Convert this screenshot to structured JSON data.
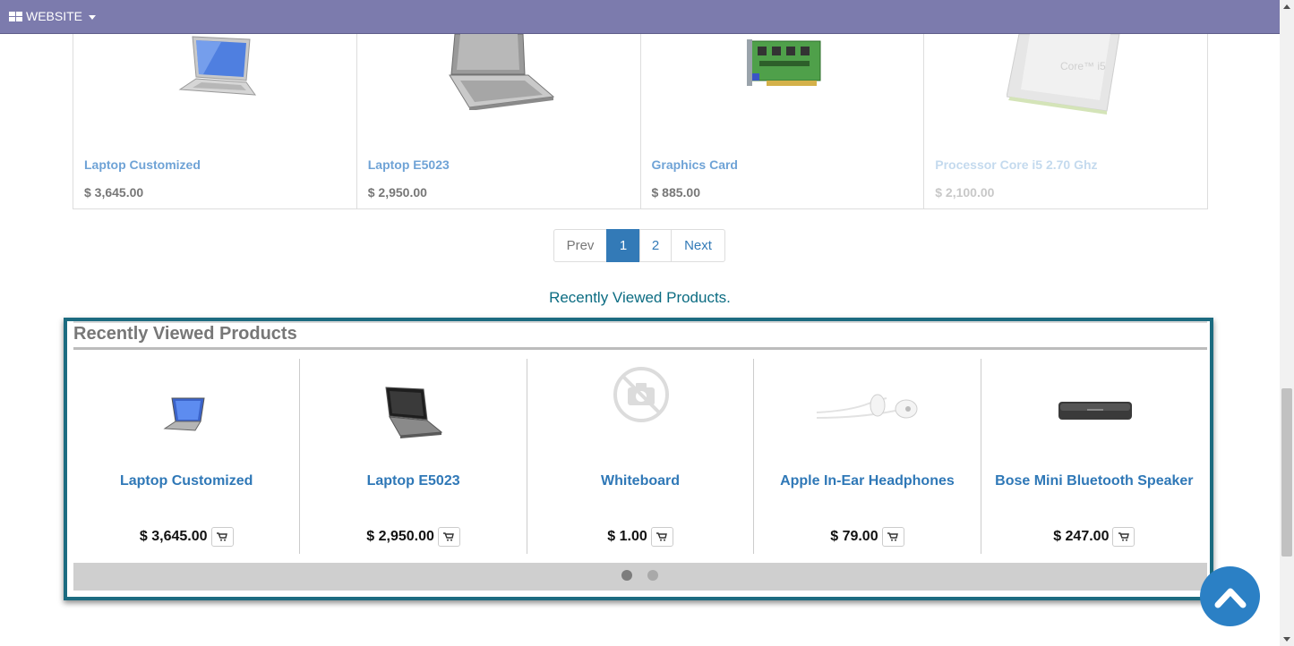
{
  "topbar": {
    "menu_label": "WEBSITE",
    "background": "#7c7bad"
  },
  "products": [
    {
      "name": "Laptop Customized",
      "price": "$ 3,645.00"
    },
    {
      "name": "Laptop E5023",
      "price": "$ 2,950.00"
    },
    {
      "name": "Graphics Card",
      "price": "$ 885.00"
    },
    {
      "name": "Processor Core i5 2.70 Ghz",
      "price": "$ 2,100.00"
    }
  ],
  "pagination": {
    "prev": "Prev",
    "pages": [
      "1",
      "2"
    ],
    "active": "1",
    "next": "Next"
  },
  "recent_link": "Recently Viewed Products.",
  "recent": {
    "title": "Recently Viewed Products",
    "items": [
      {
        "name": "Laptop Customized",
        "price": "$ 3,645.00"
      },
      {
        "name": "Laptop E5023",
        "price": "$ 2,950.00"
      },
      {
        "name": "Whiteboard",
        "price": "$ 1.00"
      },
      {
        "name": "Apple In-Ear Headphones",
        "price": "$ 79.00"
      },
      {
        "name": "Bose Mini Bluetooth Speaker",
        "price": "$ 247.00"
      }
    ]
  },
  "icons": {
    "cart": "cart-icon",
    "back_to_top": "chevron-up-icon",
    "menu": "grid-icon"
  }
}
